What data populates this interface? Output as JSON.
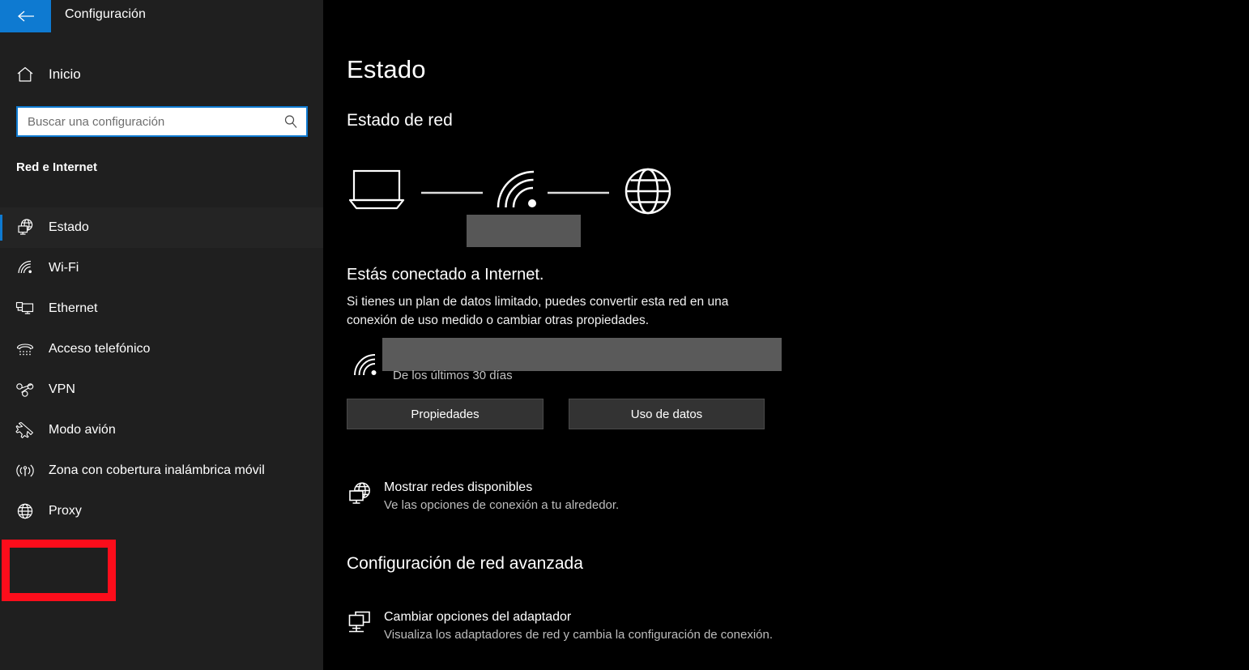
{
  "app": {
    "title": "Configuración",
    "back_icon": "back-arrow-icon"
  },
  "sidebar": {
    "home": {
      "label": "Inicio",
      "icon": "home-icon"
    },
    "search": {
      "value": "",
      "placeholder": "Buscar una configuración",
      "icon": "search-icon"
    },
    "category_heading": "Red e Internet",
    "items": [
      {
        "label": "Estado",
        "icon": "network-status-icon",
        "selected": true
      },
      {
        "label": "Wi-Fi",
        "icon": "wifi-icon",
        "selected": false
      },
      {
        "label": "Ethernet",
        "icon": "ethernet-icon",
        "selected": false
      },
      {
        "label": "Acceso telefónico",
        "icon": "dialup-phone-icon",
        "selected": false
      },
      {
        "label": "VPN",
        "icon": "vpn-icon",
        "selected": false
      },
      {
        "label": "Modo avión",
        "icon": "airplane-icon",
        "selected": false
      },
      {
        "label": "Zona con cobertura inalámbrica móvil",
        "icon": "hotspot-icon",
        "selected": false
      },
      {
        "label": "Proxy",
        "icon": "globe-icon",
        "selected": false
      }
    ],
    "highlight": {
      "target_label": "Proxy",
      "color": "#fc0d1b"
    }
  },
  "main": {
    "page_title": "Estado",
    "network_status": {
      "heading": "Estado de red",
      "diagram": {
        "device_icon": "laptop-icon",
        "link_icon": "wifi-signal-icon",
        "internet_icon": "globe-icon",
        "device_name_redacted": true
      },
      "connected_title": "Estás conectado a Internet.",
      "connected_description": "Si tienes un plan de datos limitado, puedes convertir esta red en una conexión de uso medido o cambiar otras propiedades.",
      "usage": {
        "icon": "wifi-signal-icon",
        "network_name_redacted": true,
        "caption": "De los últimos 30 días"
      },
      "buttons": {
        "properties": "Propiedades",
        "data_usage": "Uso de datos"
      },
      "available_networks": {
        "icon": "network-globe-monitor-icon",
        "title": "Mostrar redes disponibles",
        "subtitle": "Ve las opciones de conexión a tu alrededor."
      }
    },
    "advanced": {
      "heading": "Configuración de red avanzada",
      "adapter_options": {
        "icon": "adapter-monitors-icon",
        "title": "Cambiar opciones del adaptador",
        "subtitle": "Visualiza los adaptadores de red y cambia la configuración de conexión."
      }
    }
  },
  "colors": {
    "accent": "#0e7ad1",
    "sidebar_bg": "#1f1f1f",
    "main_bg": "#000000",
    "redaction": "#575757",
    "highlight_red": "#fc0d1b"
  }
}
